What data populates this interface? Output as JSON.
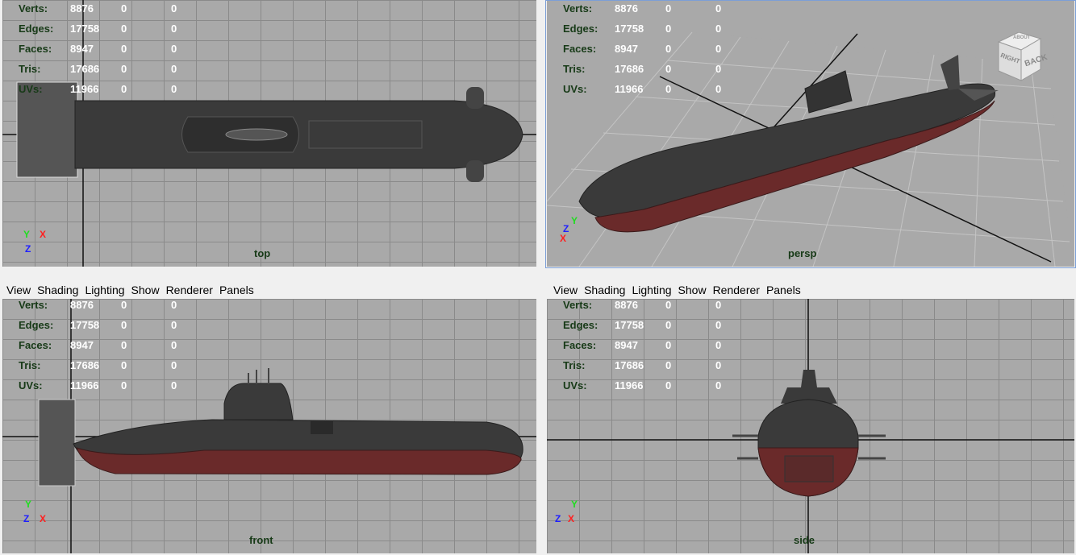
{
  "menu": {
    "view": "View",
    "shading": "Shading",
    "lighting": "Lighting",
    "show": "Show",
    "renderer": "Renderer",
    "panels": "Panels"
  },
  "hud": {
    "rows": [
      {
        "label": "Verts:",
        "values": [
          "8876",
          "0",
          "0"
        ]
      },
      {
        "label": "Edges:",
        "values": [
          "17758",
          "0",
          "0"
        ]
      },
      {
        "label": "Faces:",
        "values": [
          "8947",
          "0",
          "0"
        ]
      },
      {
        "label": "Tris:",
        "values": [
          "17686",
          "0",
          "0"
        ]
      },
      {
        "label": "UVs:",
        "values": [
          "11966",
          "0",
          "0"
        ]
      }
    ]
  },
  "viewports": {
    "top": "top",
    "persp": "persp",
    "front": "front",
    "side": "side"
  },
  "viewcube": {
    "face1": "RIGHT",
    "face2": "BACK",
    "face3": "ABOUT"
  },
  "axes": {
    "x": "X",
    "y": "Y",
    "z": "Z"
  },
  "colors": {
    "viewport_bg": "#a9a9a9",
    "grid": "#8a8a8a",
    "hud_label": "#173a17",
    "hud_value": "#ffffff",
    "hull_dark": "#3a3a3a",
    "hull_red": "#6a2a2a",
    "axis_x": "#ff2020",
    "axis_y": "#20dd20",
    "axis_z": "#2020ff"
  }
}
